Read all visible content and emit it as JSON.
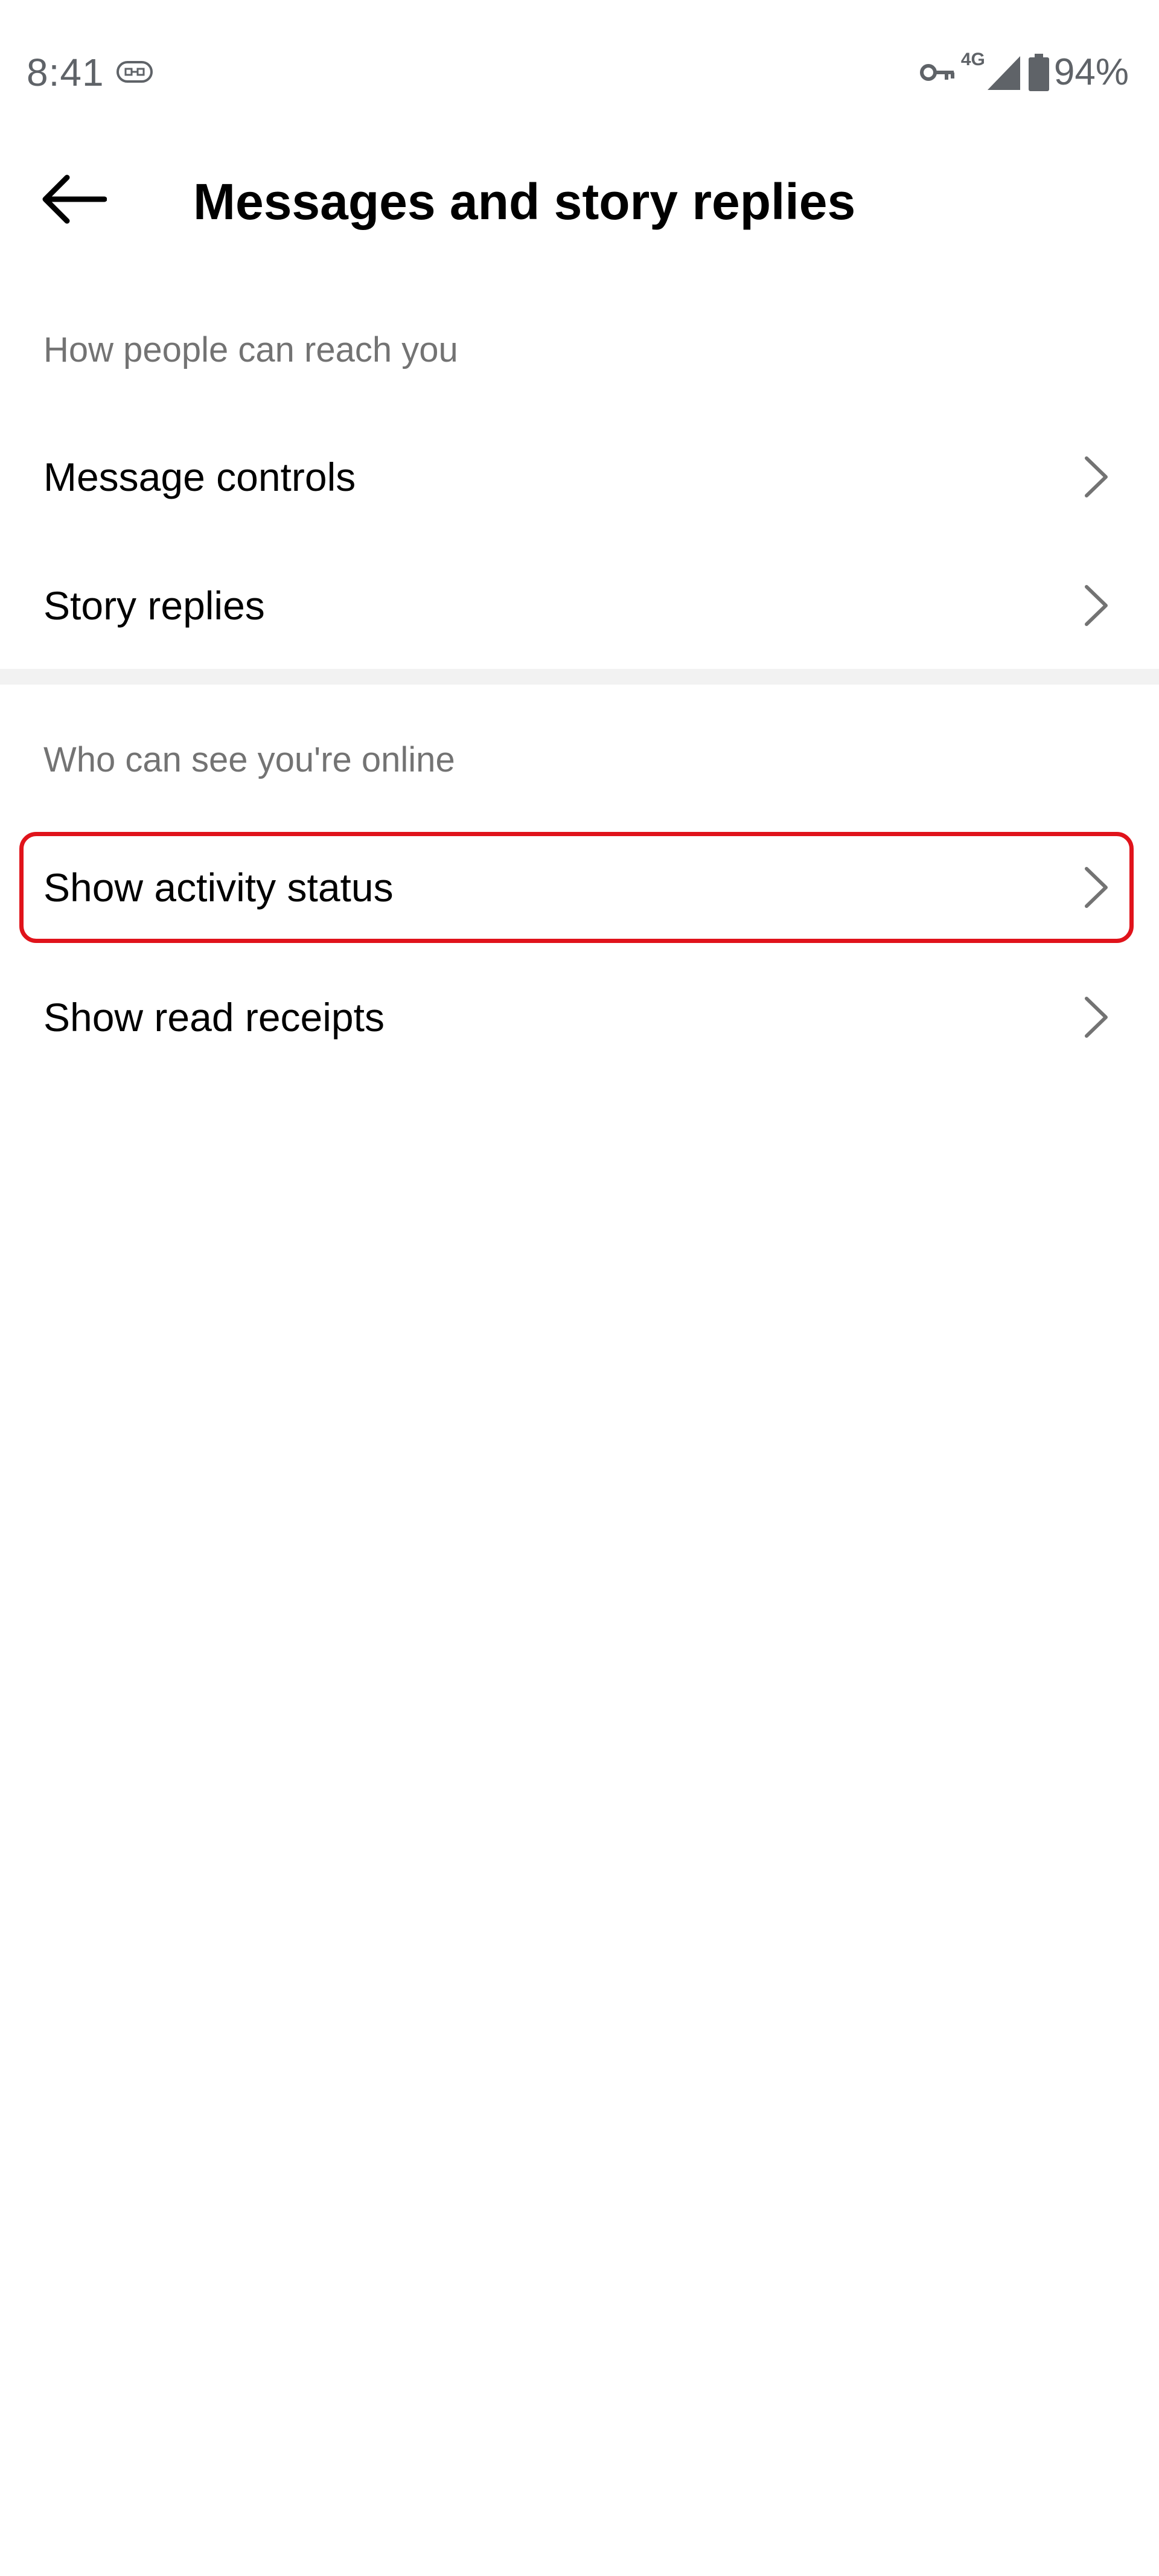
{
  "status_bar": {
    "time": "8:41",
    "network_type": "4G",
    "battery_percent": "94%",
    "icons": [
      "data-saver-icon",
      "vpn-key-icon",
      "signal-icon",
      "battery-icon"
    ]
  },
  "header": {
    "back_icon": "arrow-left-icon",
    "title": "Messages and story replies"
  },
  "sections": [
    {
      "header": "How people can reach you",
      "items": [
        {
          "label": "Message controls"
        },
        {
          "label": "Story replies"
        }
      ]
    },
    {
      "header": "Who can see you're online",
      "items": [
        {
          "label": "Show activity status"
        },
        {
          "label": "Show read receipts"
        }
      ]
    }
  ],
  "colors": {
    "highlight_border": "#e0131b",
    "section_header_text": "#737373",
    "divider": "#f2f2f2",
    "status_text": "#5f6368"
  }
}
